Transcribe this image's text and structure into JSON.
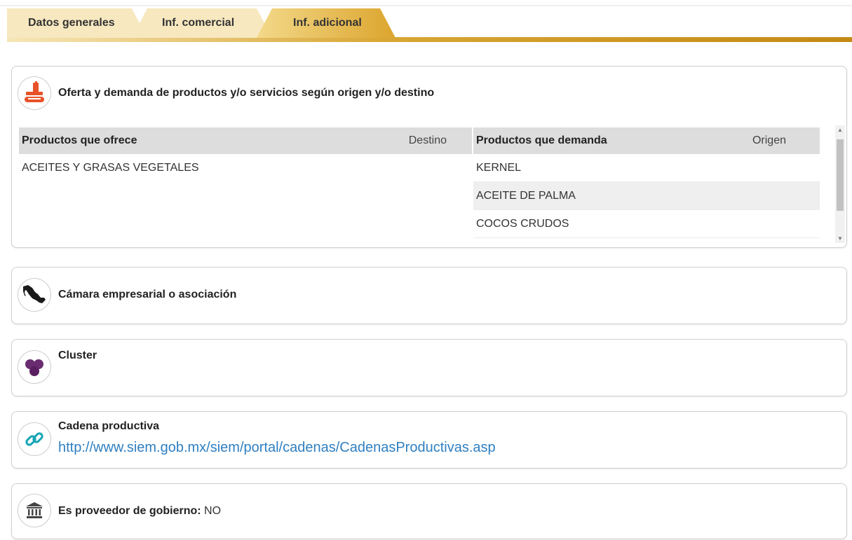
{
  "tabs": [
    {
      "label": "Datos generales"
    },
    {
      "label": "Inf. comercial"
    },
    {
      "label": "Inf. adicional"
    }
  ],
  "oferta": {
    "title": "Oferta y demanda de productos y/o servicios según origen y/o destino",
    "offer_header": "Productos que ofrece",
    "destino_header": "Destino",
    "demand_header": "Productos que demanda",
    "origen_header": "Origen",
    "offers": [
      "ACEITES Y GRASAS VEGETALES"
    ],
    "demands": [
      "KERNEL",
      "ACEITE DE PALMA",
      "COCOS CRUDOS"
    ]
  },
  "camara": {
    "title": "Cámara empresarial o asociación"
  },
  "cluster": {
    "title": "Cluster"
  },
  "cadena": {
    "title": "Cadena productiva",
    "url": "http://www.siem.gob.mx/siem/portal/cadenas/CadenasProductivas.asp"
  },
  "gobierno": {
    "label": "Es proveedor de gobierno:",
    "value": " NO"
  },
  "colors": {
    "accent_gold": "#c48a14",
    "active_tab": "#e2b13d",
    "inactive_tab": "#f7e8c0",
    "link": "#2f7fc0"
  },
  "icons": [
    "scale-icon",
    "mexico-map-icon",
    "cluster-icon",
    "chain-link-icon",
    "government-building-icon"
  ]
}
